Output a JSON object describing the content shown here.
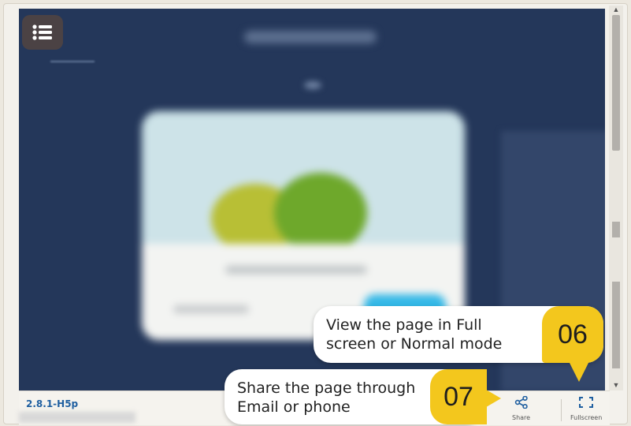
{
  "footer": {
    "version": "2.8.1-H5p",
    "share_label": "Share",
    "fullscreen_label": "Fullscreen"
  },
  "callouts": [
    {
      "number": "06",
      "text_line1": "View the page in Full",
      "text_line2": "screen or Normal mode"
    },
    {
      "number": "07",
      "text_line1": "Share the page through",
      "text_line2": "Email or phone"
    }
  ],
  "colors": {
    "stage_bg": "#24375a",
    "badge": "#f3c71d",
    "link_blue": "#1f5fa0",
    "icon_blue": "#1f5fa0"
  },
  "icons": {
    "menu": "list-icon",
    "share": "share-icon",
    "fullscreen": "fullscreen-icon"
  }
}
